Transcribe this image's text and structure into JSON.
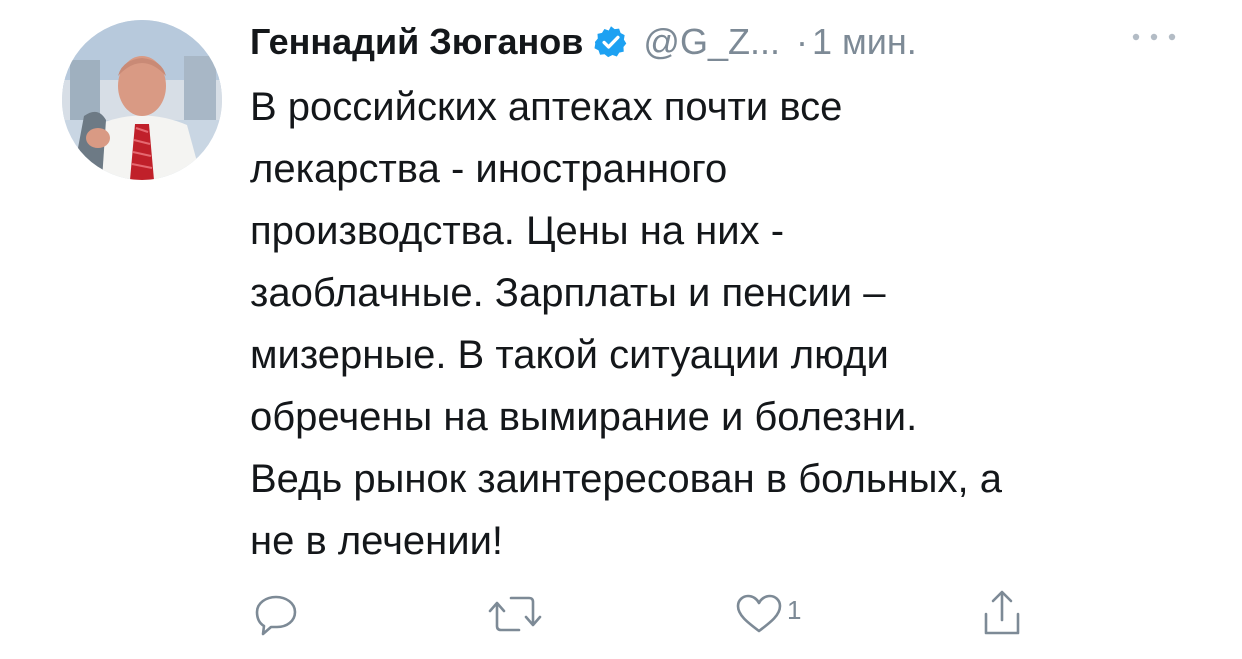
{
  "tweet": {
    "display_name": "Геннадий Зюганов",
    "handle": "@G_Z...",
    "separator": "·",
    "time": "1 мин.",
    "verified": true,
    "body_lines": [
      "В российских аптеках почти все",
      "лекарства - иностранного",
      "производства. Цены на них -",
      "заоблачные. Зарплаты и пенсии –",
      "мизерные. В такой ситуации люди",
      "обречены на вымирание и болезни.",
      "Ведь рынок заинтересован в больных, а",
      "не в лечении!"
    ],
    "actions": {
      "reply_icon": "reply-icon",
      "retweet_icon": "retweet-icon",
      "like_icon": "heart-icon",
      "like_count": "1",
      "share_icon": "share-icon"
    }
  },
  "colors": {
    "text": "#14171a",
    "secondary": "#7d8a96",
    "verified": "#1da1f2"
  }
}
